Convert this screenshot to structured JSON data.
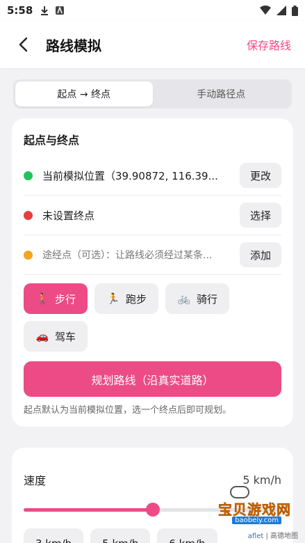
{
  "status": {
    "time": "5:58"
  },
  "appbar": {
    "title": "路线模拟",
    "save_label": "保存路线"
  },
  "tabs": [
    {
      "label": "起点 → 终点",
      "active": true
    },
    {
      "label": "手动路径点",
      "active": false
    }
  ],
  "route_card": {
    "title": "起点与终点",
    "rows": [
      {
        "text": "当前模拟位置（39.90872, 116.39...",
        "button": "更改",
        "dot_color": "#22c35a"
      },
      {
        "text": "未设置终点",
        "button": "选择",
        "dot_color": "#e53e3e"
      },
      {
        "text": "途经点（可选）：让路线必须经过某条...",
        "button": "添加",
        "dot_color": "#f2a51f"
      }
    ],
    "modes": [
      {
        "label": "步行",
        "icon": "walk-icon",
        "glyph": "🚶",
        "active": true
      },
      {
        "label": "跑步",
        "icon": "run-icon",
        "glyph": "🏃",
        "active": false
      },
      {
        "label": "骑行",
        "icon": "bike-icon",
        "glyph": "🚲",
        "active": false
      },
      {
        "label": "驾车",
        "icon": "car-icon",
        "glyph": "🚗",
        "active": false
      }
    ],
    "plan_button": "规划路线（沿真实道路）",
    "hint": "起点默认为当前模拟位置，选一个终点后即可规划。"
  },
  "speed_card": {
    "label": "速度",
    "value": "5 km/h",
    "slider_fraction": 0.5,
    "presets": [
      "3 km/h",
      "5 km/h",
      "6 km/h"
    ]
  },
  "watermark": {
    "text": "宝贝游戏网",
    "site": "baobeiy.com"
  },
  "attribution": {
    "leaflet": "aflet",
    "separator": " | ",
    "amap": "高德地图"
  },
  "colors": {
    "accent": "#ec4b86"
  }
}
